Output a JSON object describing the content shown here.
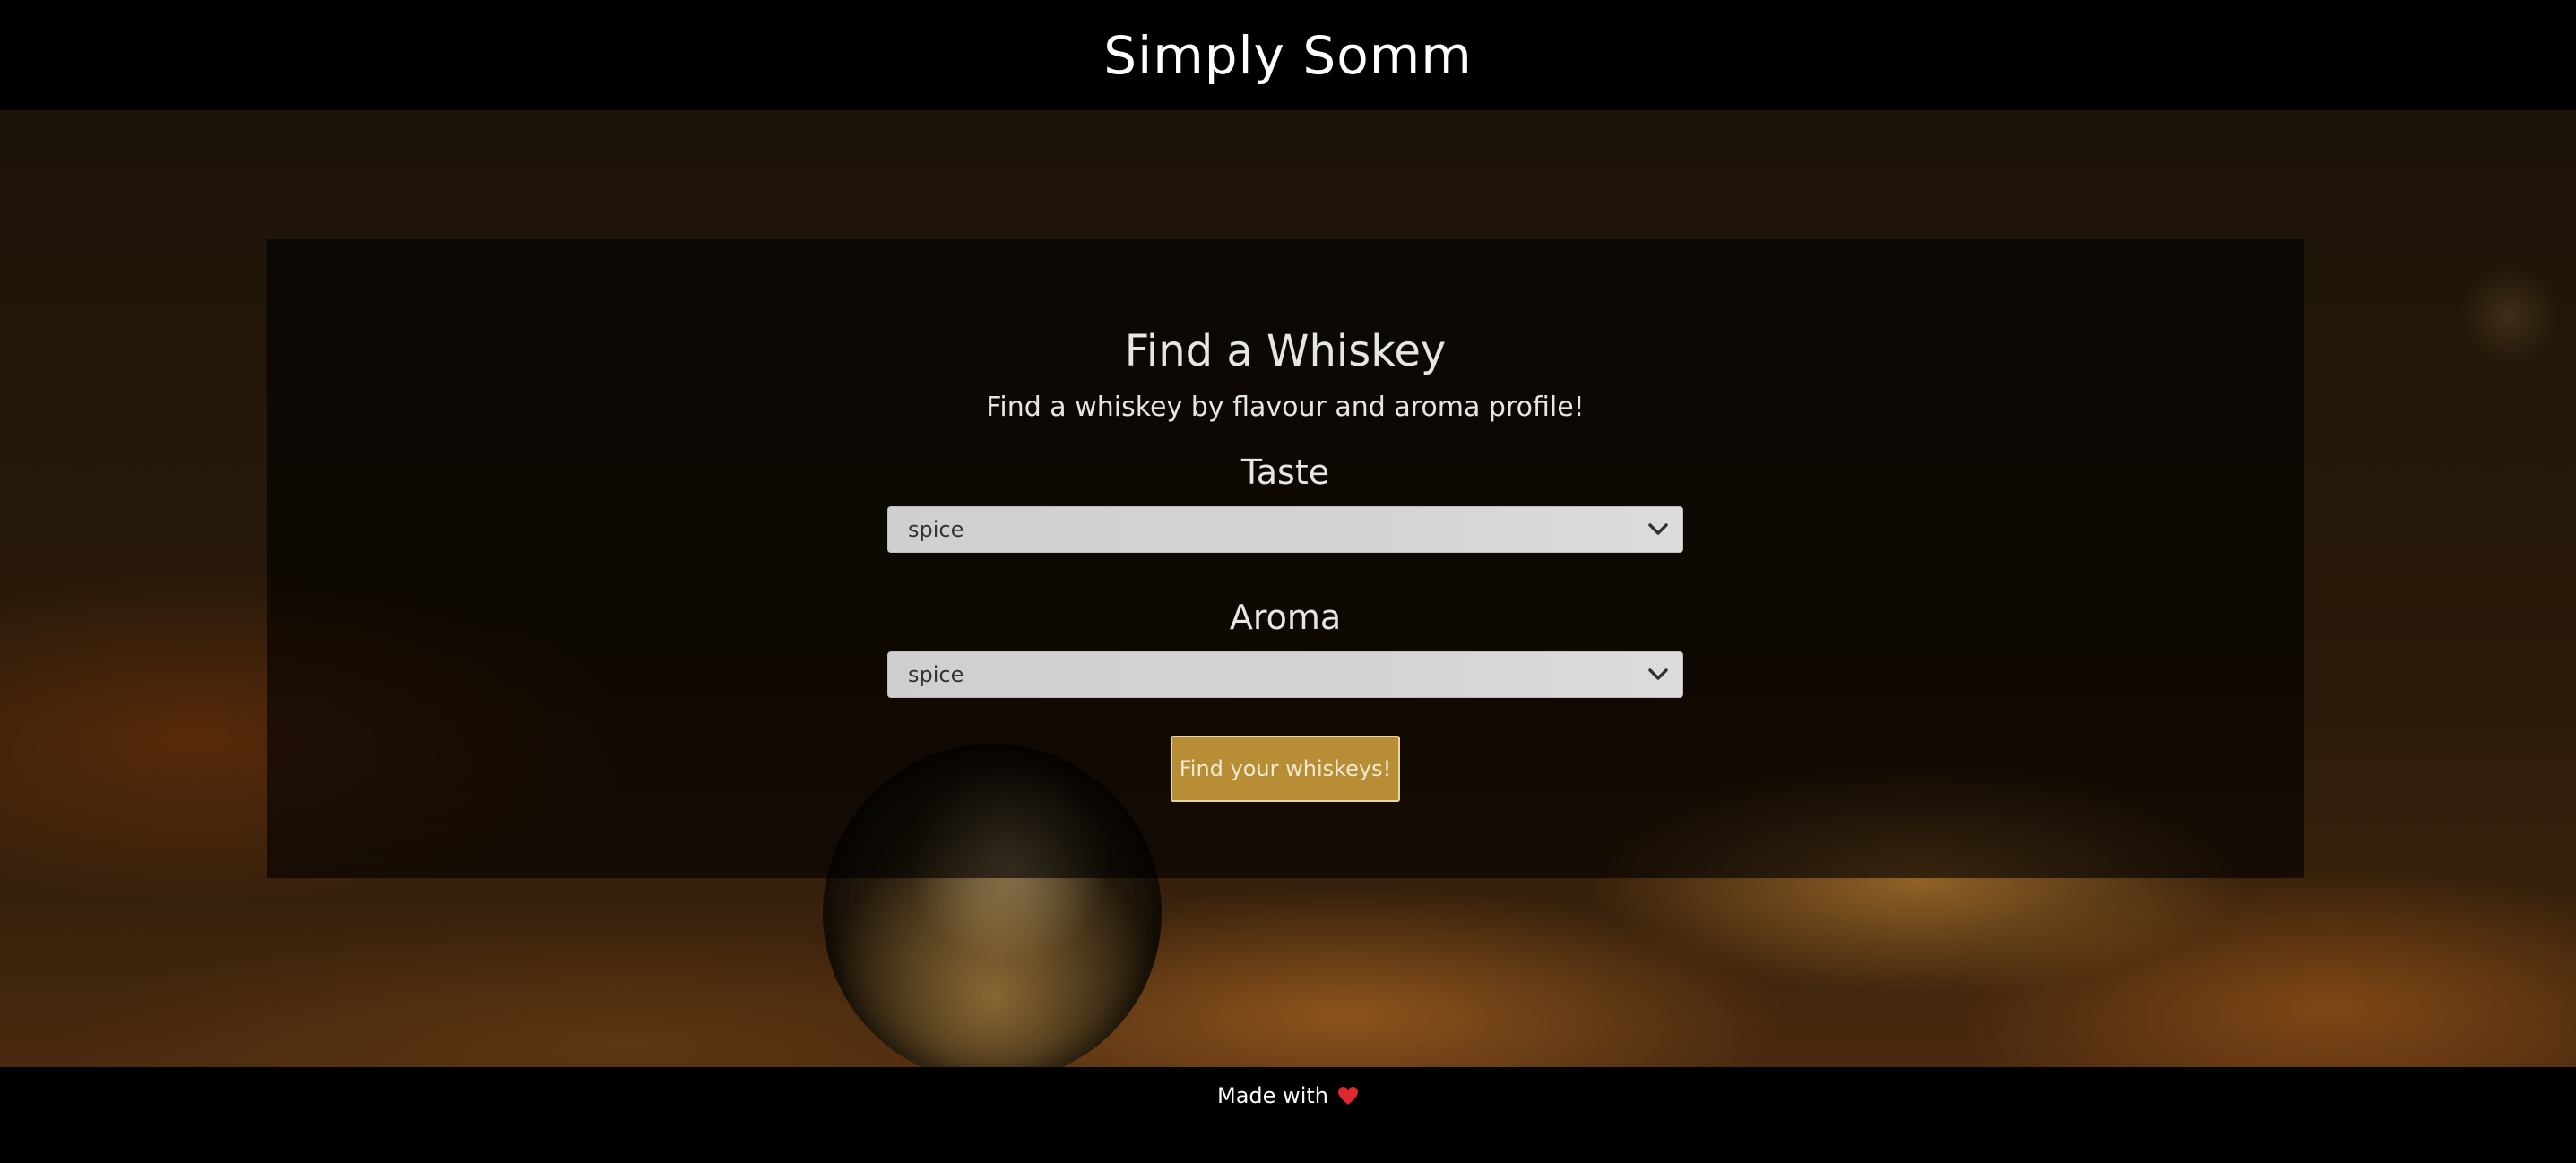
{
  "header": {
    "title": "Simply Somm"
  },
  "finder": {
    "title": "Find a Whiskey",
    "subtitle": "Find a whiskey by flavour and aroma profile!",
    "taste": {
      "label": "Taste",
      "selected": "spice"
    },
    "aroma": {
      "label": "Aroma",
      "selected": "spice"
    },
    "submit_label": "Find your whiskeys!"
  },
  "footer": {
    "text": "Made with",
    "icon": "heart-icon"
  },
  "colors": {
    "header_bg": "#000000",
    "button_bg": "#b78e35",
    "heart": "#e0292f"
  }
}
